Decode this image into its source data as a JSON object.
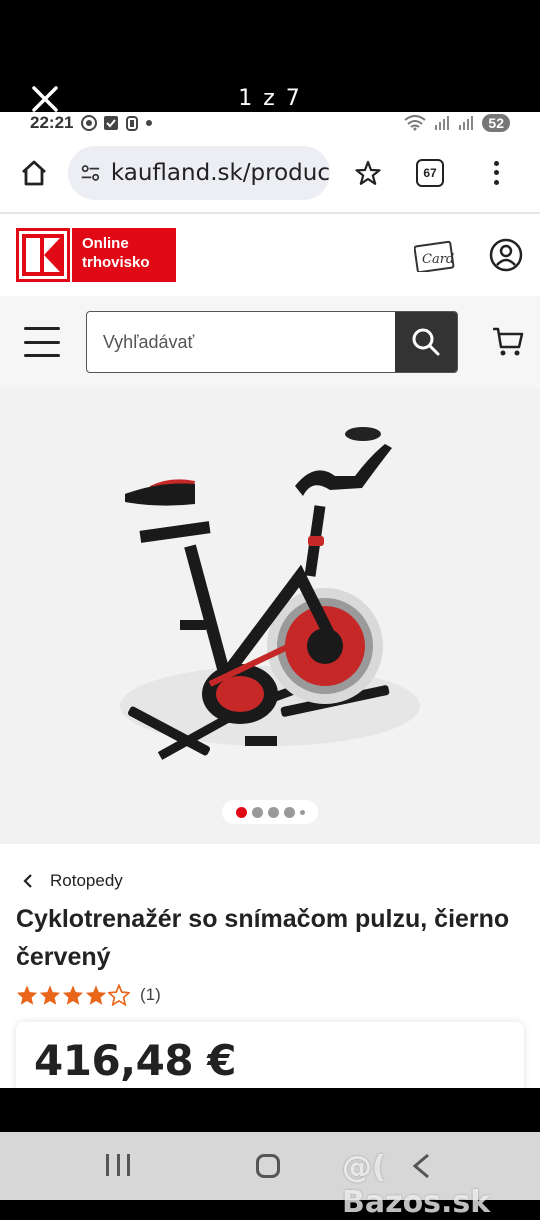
{
  "viewer": {
    "counter": "1 z 7"
  },
  "statusbar": {
    "time": "22:21",
    "battery": "52"
  },
  "browser": {
    "url": "kaufland.sk/produc",
    "tab_count": "67"
  },
  "site": {
    "logo_label_line1": "Online",
    "logo_label_line2": "trhovisko",
    "search_placeholder": "Vyhľadávať"
  },
  "product": {
    "breadcrumb": "Rotopedy",
    "title": "Cyklotrenažér so snímačom pulzu, čierno červený",
    "rating_value": 4,
    "rating_max": 5,
    "rating_count": "(1)",
    "price": "416,48 €",
    "gallery_dots": 5,
    "active_image": 1
  },
  "watermark": "@( Bazos.sk",
  "colors": {
    "brand_red": "#e10915",
    "star_orange": "#e8651a"
  }
}
